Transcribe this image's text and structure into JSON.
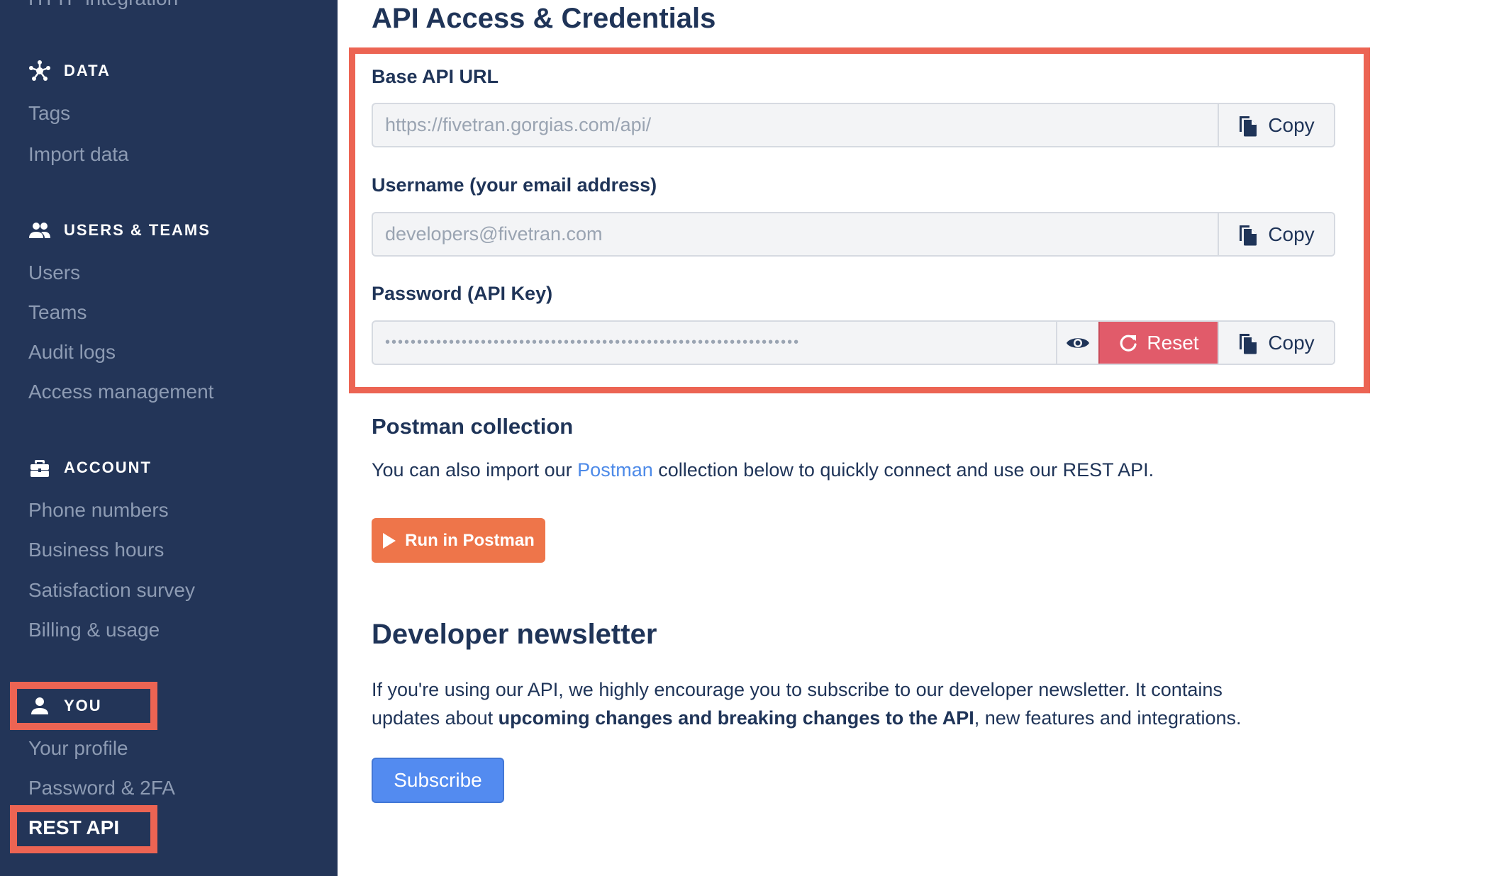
{
  "sidebar": {
    "truncated_item": "HTTP integration",
    "sections": [
      {
        "title": "DATA",
        "icon": "data-network-icon",
        "items": [
          "Tags",
          "Import data"
        ]
      },
      {
        "title": "USERS & TEAMS",
        "icon": "users-icon",
        "items": [
          "Users",
          "Teams",
          "Audit logs",
          "Access management"
        ]
      },
      {
        "title": "ACCOUNT",
        "icon": "briefcase-icon",
        "items": [
          "Phone numbers",
          "Business hours",
          "Satisfaction survey",
          "Billing & usage"
        ]
      },
      {
        "title": "YOU",
        "icon": "person-icon",
        "items": [
          "Your profile",
          "Password & 2FA",
          "REST API"
        ]
      }
    ],
    "active_item": "REST API"
  },
  "main": {
    "title": "API Access & Credentials",
    "fields": [
      {
        "label": "Base API URL",
        "value": "https://fivetran.gorgias.com/api/",
        "copy_label": "Copy"
      },
      {
        "label": "Username (your email address)",
        "value": "developers@fivetran.com",
        "copy_label": "Copy"
      },
      {
        "label": "Password (API Key)",
        "value": "•••••••••••••••••••••••••••••••••••••••••••••••••••••••••••••••••",
        "reset_label": "Reset",
        "copy_label": "Copy"
      }
    ],
    "postman": {
      "title": "Postman collection",
      "text_before": "You can also import our ",
      "link": "Postman",
      "text_after": " collection below to quickly connect and use our REST API.",
      "button_label": "Run in Postman"
    },
    "newsletter": {
      "title": "Developer newsletter",
      "line1": "If you're using our API, we highly encourage you to subscribe to our developer newsletter. It contains",
      "line2_before": "updates about ",
      "line2_bold": "upcoming changes and breaking changes to the API",
      "line2_after": ", new features and integrations.",
      "button_label": "Subscribe"
    }
  },
  "colors": {
    "sidebar_bg": "#233558",
    "highlight": "#ec6453",
    "reset_red": "#e15b6a",
    "postman_orange": "#ee754a",
    "subscribe_blue": "#538bf0",
    "link_blue": "#4d8ae8",
    "text_navy": "#1f3458"
  }
}
